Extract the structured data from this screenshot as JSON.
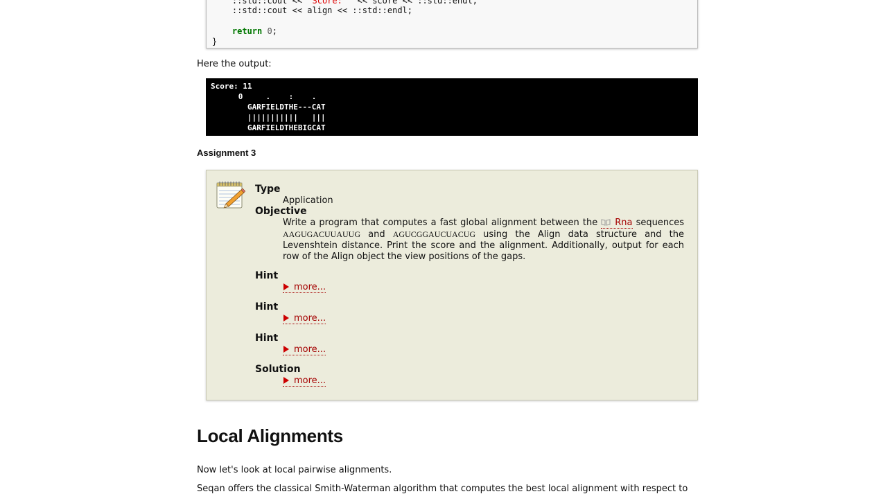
{
  "code": {
    "line1_prefix": "::std::cout << ",
    "line1_str": "\"Score: \"",
    "line1_suffix": " << score << ::std::endl;",
    "line2": "::std::cout << align << ::std::endl;",
    "line3_kw": "return",
    "line3_num": "0",
    "line3_end": ";",
    "line4": "}"
  },
  "output_intro": "Here the output:",
  "output": {
    "lines": [
      "Score: 11",
      "      0     .    :    .",
      "        GARFIELDTHE---CAT",
      "        |||||||||||   |||",
      "        GARFIELDTHEBIGCAT"
    ]
  },
  "assignment": {
    "title": "Assignment 3",
    "type_label": "Type",
    "type_value": "Application",
    "objective_label": "Objective",
    "objective_part1": "Write a program that computes a fast global alignment between the ",
    "objective_link": "Rna",
    "objective_part2": " sequences ",
    "seq1": "AAGUGACUUAUUG",
    "objective_part3": " and ",
    "seq2": "AGUCGGAUCUACUG",
    "objective_part4": " using the Align data structure and the Levenshtein distance. Print the score and the alignment. Additionally, output for each row of the Align object the view positions of the gaps.",
    "hints": [
      {
        "label": "Hint",
        "more": "more..."
      },
      {
        "label": "Hint",
        "more": "more..."
      },
      {
        "label": "Hint",
        "more": "more..."
      }
    ],
    "solution_label": "Solution",
    "solution_more": "more..."
  },
  "local": {
    "heading": "Local Alignments",
    "intro": "Now let's look at local pairwise alignments.",
    "next_line": "Seqan offers the classical Smith-Waterman algorithm that computes the best local alignment with respect to"
  },
  "icons": {
    "notepad": "notepad-pencil-icon",
    "book": "book-icon",
    "triangle": "triangle-right-icon"
  },
  "colors": {
    "link": "#a40000",
    "box_bg": "#ececdc",
    "keyword": "#007700",
    "string": "#dd0000"
  }
}
